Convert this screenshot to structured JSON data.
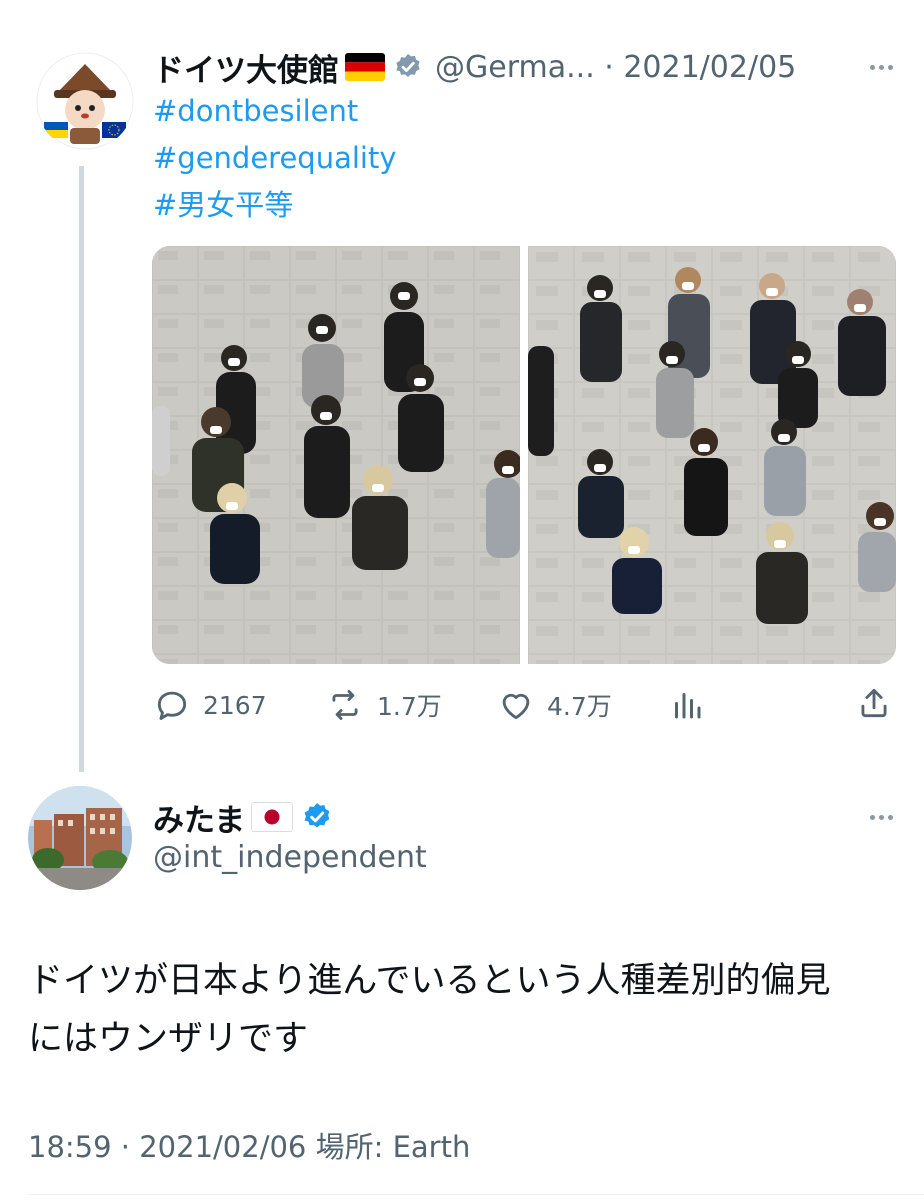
{
  "tweet": {
    "author_name": "ドイツ大使館",
    "handle_date": "@Germa... · 2021/02/05",
    "hashtags": [
      "#dontbesilent",
      "#genderequality",
      "#男女平等"
    ],
    "actions": {
      "reply_count": "2167",
      "retweet_count": "1.7万",
      "like_count": "4.7万"
    }
  },
  "reply": {
    "author_name": "みたま",
    "handle": "@int_independent",
    "text_line1": "ドイツが日本より進んでいるという人種差別的偏見",
    "text_line2": "にはウンザリです",
    "timestamp": "18:59 · 2021/02/06 場所: Earth"
  },
  "colors": {
    "link": "#1d9bf0",
    "verified": "#1d9bf0",
    "muted": "#536471"
  },
  "icons": [
    "verified-badge-icon",
    "more-dots-icon",
    "reply-icon",
    "retweet-icon",
    "like-icon",
    "views-icon",
    "share-icon"
  ]
}
